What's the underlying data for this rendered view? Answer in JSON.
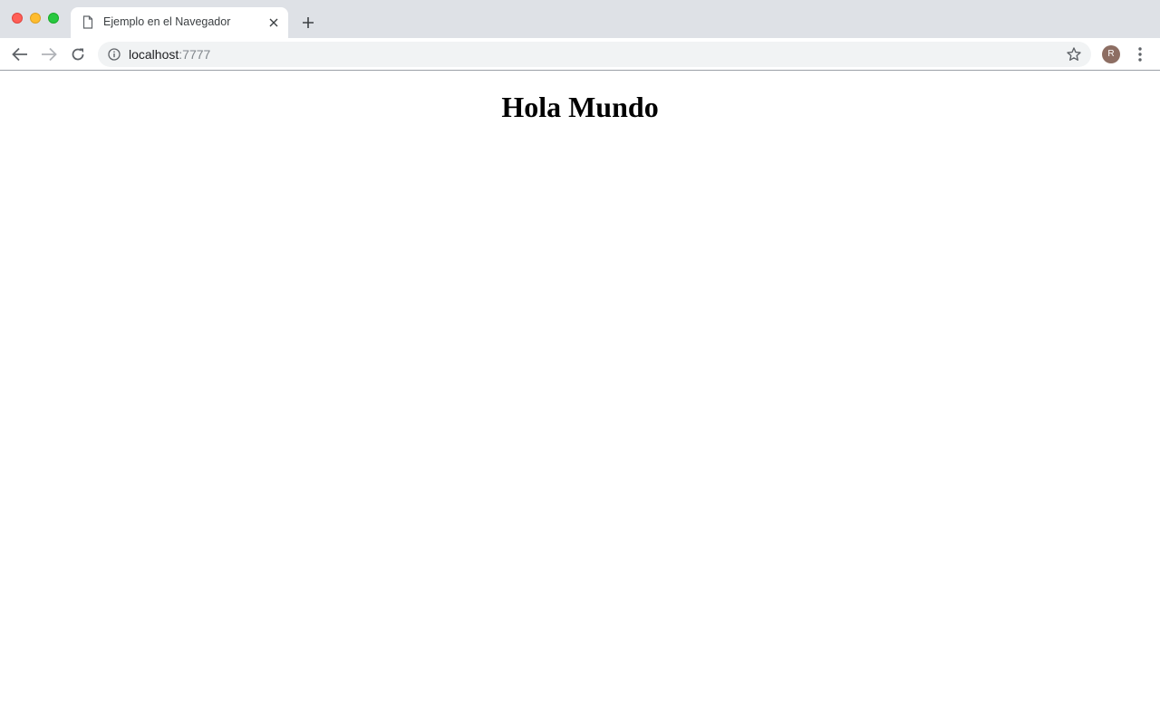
{
  "tab": {
    "title": "Ejemplo en el Navegador",
    "favicon": "document-icon"
  },
  "address_bar": {
    "host": "localhost",
    "port": ":7777"
  },
  "profile": {
    "initial": "R",
    "color": "#8d6e63"
  },
  "page": {
    "heading": "Hola Mundo"
  },
  "colors": {
    "tabstrip": "#dee1e6",
    "omnibox": "#f1f3f4",
    "close": "#ff5f57",
    "minimize": "#febc2e",
    "maximize": "#28c840"
  }
}
